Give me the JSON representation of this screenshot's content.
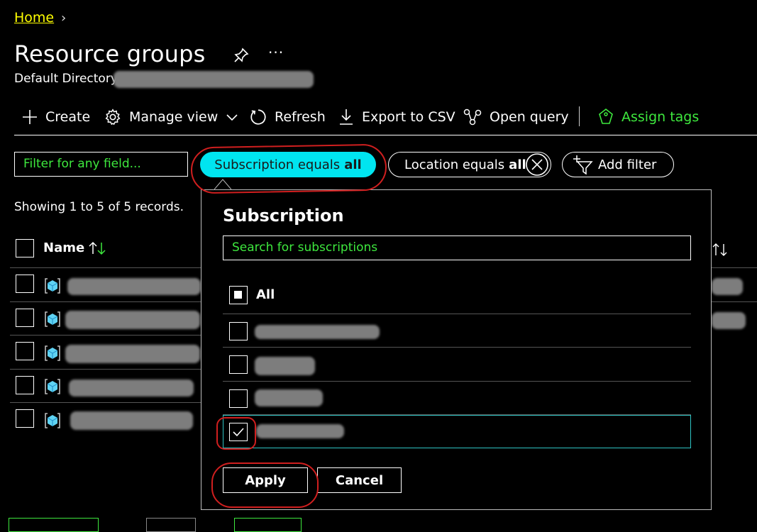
{
  "breadcrumb": {
    "home": "Home"
  },
  "page": {
    "title": "Resource groups",
    "directory": "Default Directory"
  },
  "icons": {
    "pin": "pin-icon",
    "more": "more-icon"
  },
  "toolbar": {
    "create": "Create",
    "manage_view": "Manage view",
    "refresh": "Refresh",
    "export": "Export to CSV",
    "open_query": "Open query",
    "assign_tags": "Assign tags"
  },
  "filters": {
    "search_placeholder": "Filter for any field...",
    "subscription_prefix": "Subscription equals",
    "subscription_value": "all",
    "location_prefix": "Location equals",
    "location_value": "all",
    "add_filter": "Add filter"
  },
  "records_text": "Showing 1 to 5 of 5 records.",
  "table": {
    "name_header": "Name",
    "row_count": 5
  },
  "panel": {
    "title": "Subscription",
    "search_placeholder": "Search for subscriptions",
    "all_label": "All",
    "apply": "Apply",
    "cancel": "Cancel"
  },
  "colors": {
    "accent_green": "#3ee83e",
    "subscription_pill": "#00e5f0",
    "annotation_red": "#d01f1f",
    "selected_outline": "#2ec4c4"
  }
}
